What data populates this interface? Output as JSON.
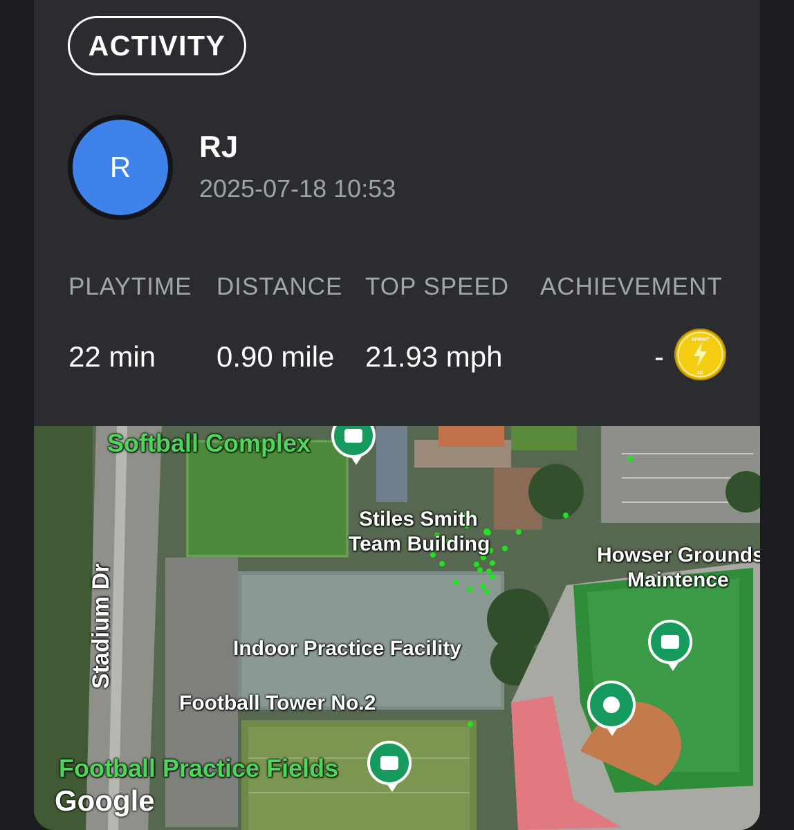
{
  "header": {
    "activity_label": "ACTIVITY"
  },
  "user": {
    "initial": "R",
    "name": "RJ",
    "timestamp": "2025-07-18 10:53"
  },
  "stats": {
    "playtime_label": "PLAYTIME",
    "distance_label": "DISTANCE",
    "top_speed_label": "TOP SPEED",
    "achievement_label": "ACHIEVEMENT",
    "playtime_value": "22 min",
    "distance_value": "0.90 mile",
    "top_speed_value": "21.93 mph",
    "achievement_value": "-",
    "badge_icon": "sprint-1k-badge-icon",
    "badge_text_top": "SPRINT",
    "badge_text_bottom": "1K"
  },
  "map": {
    "labels": {
      "softball": "Softball Complex",
      "stiles": "Stiles Smith",
      "team_building": "Team Building",
      "howser": "Howser Grounds",
      "maintence": "Maintence",
      "stadium": "Stadium Dr",
      "indoor": "Indoor Practice Facility",
      "tower": "Football Tower No.2",
      "practice_fields": "Football Practice Fields"
    },
    "attribution": "Google",
    "colors": {
      "track_points": "#22e022",
      "pin": "#169a5d",
      "avatar": "#3f83ea",
      "badge": "#e9b800"
    }
  }
}
